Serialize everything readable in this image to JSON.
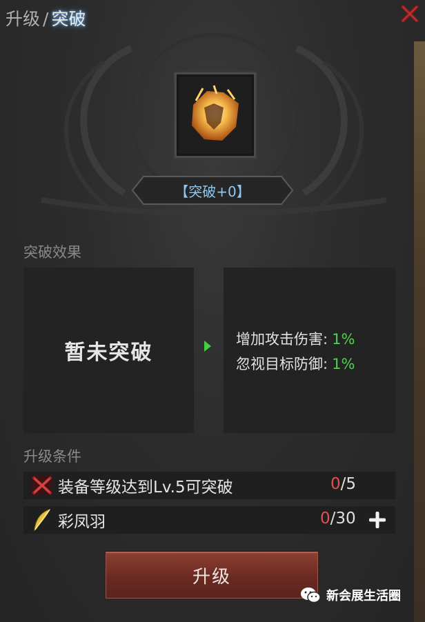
{
  "header": {
    "tab_upgrade": "升级",
    "separator": "/",
    "tab_breakthrough": "突破"
  },
  "item": {
    "level_label": "【突破+0】"
  },
  "effect": {
    "section_title": "突破效果",
    "current_state": "暂未突破",
    "next": [
      {
        "label": "增加攻击伤害:",
        "value": "1%"
      },
      {
        "label": "忽视目标防御:",
        "value": "1%"
      }
    ]
  },
  "conditions": {
    "section_title": "升级条件",
    "items": [
      {
        "label": "装备等级达到Lv.5可突破",
        "current": "0",
        "total": "/5",
        "icon": "crossed-swords-icon"
      },
      {
        "label": "彩凤羽",
        "current": "0",
        "total": "/30",
        "icon": "feather-icon"
      }
    ]
  },
  "button": {
    "upgrade_label": "升级"
  },
  "watermark": {
    "text": "新会展生活圈"
  },
  "colors": {
    "accent_blue": "#8fc8f0",
    "value_green": "#4fd24f",
    "count_red": "#e05050",
    "button_red": "#6a2a22"
  }
}
